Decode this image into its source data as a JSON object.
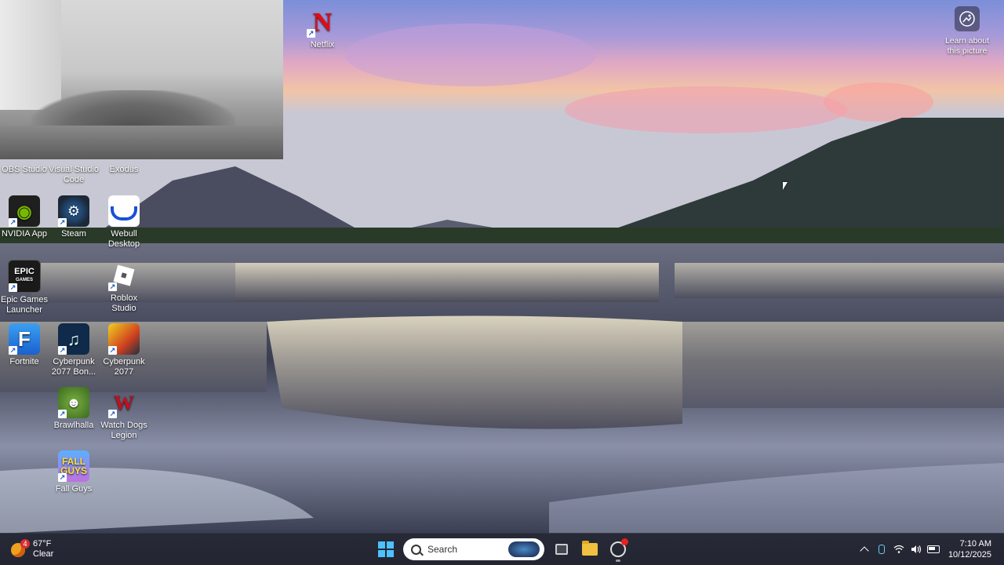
{
  "webcam": {
    "label": ""
  },
  "desktop": {
    "partial_labels": {
      "obs": "OBS Studio",
      "vscode": "Visual Studio Code",
      "exodus": "Exodus"
    },
    "icons": [
      {
        "label": "Netflix",
        "icon": "netflix-icon"
      },
      {
        "label": "NVIDIA App",
        "icon": "nvidia-icon"
      },
      {
        "label": "Steam",
        "icon": "steam-icon"
      },
      {
        "label": "Webull Desktop",
        "icon": "webull-icon"
      },
      {
        "label": "Epic Games Launcher",
        "icon": "epic-games-icon"
      },
      {
        "label": "Roblox Studio",
        "icon": "roblox-studio-icon"
      },
      {
        "label": "Fortnite",
        "icon": "fortnite-icon"
      },
      {
        "label": "Cyberpunk 2077 Bon...",
        "icon": "music-note-icon"
      },
      {
        "label": "Cyberpunk 2077",
        "icon": "cyberpunk-icon"
      },
      {
        "label": "Brawlhalla",
        "icon": "brawlhalla-icon"
      },
      {
        "label": "Watch Dogs Legion",
        "icon": "watch-dogs-icon"
      },
      {
        "label": "Fall Guys",
        "icon": "fall-guys-icon"
      }
    ],
    "glyphs": {
      "netflix": "N",
      "epic_top": "EPIC",
      "epic_bottom": "GAMES",
      "fortnite": "F",
      "cyberpunk_bonus": "♫",
      "watch_dogs": "W",
      "fall_top": "FALL",
      "fall_bottom": "GUYS",
      "shortcut": "↗"
    }
  },
  "learn_about": {
    "label": "Learn about this picture"
  },
  "taskbar": {
    "weather": {
      "temp": "67°F",
      "condition": "Clear",
      "badge": "4"
    },
    "search": {
      "placeholder": "Search"
    },
    "clock": {
      "time": "7:10 AM",
      "date": "10/12/2025"
    }
  },
  "colors": {
    "accent": "#4cc2ff",
    "taskbar": "#20222c"
  }
}
